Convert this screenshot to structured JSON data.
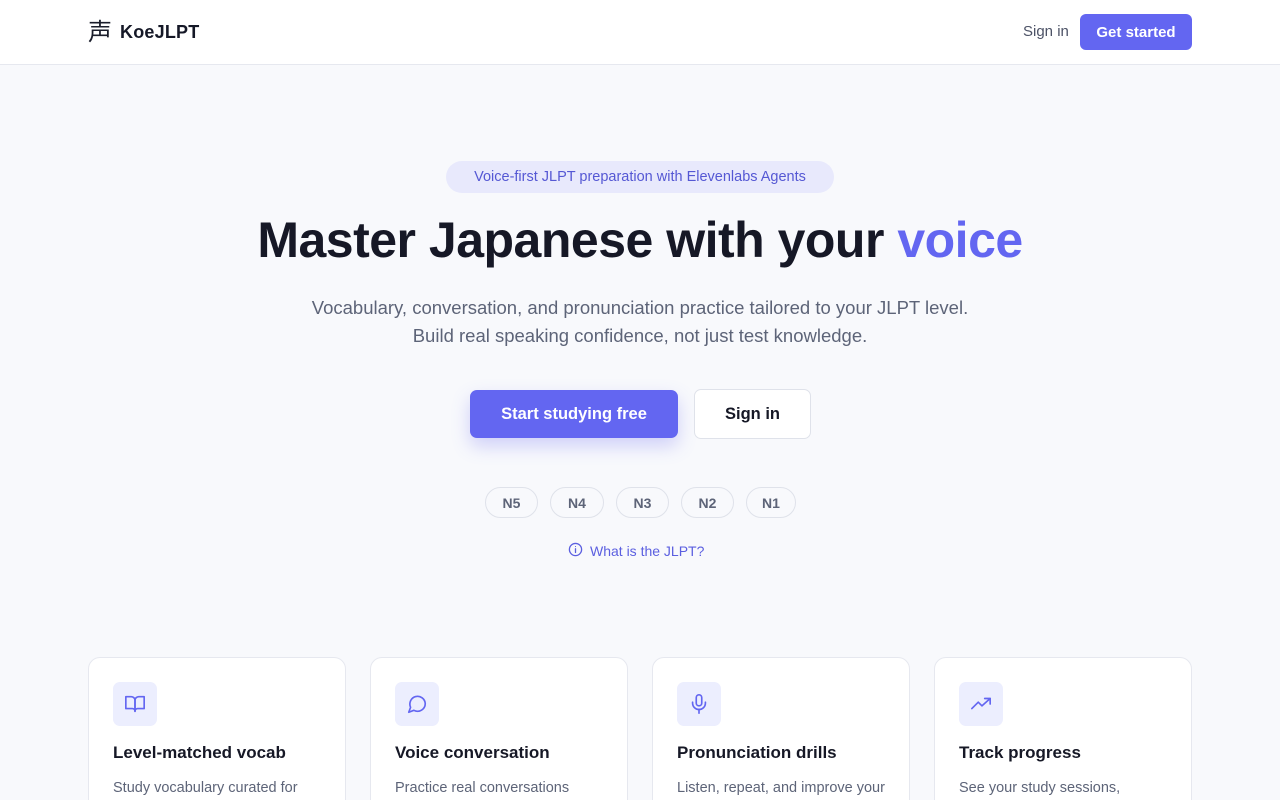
{
  "header": {
    "brand_mark": "声",
    "brand_name": "KoeJLPT",
    "sign_in_label": "Sign in",
    "get_started_label": "Get started"
  },
  "hero": {
    "pill_text": "Voice-first JLPT preparation with Elevenlabs Agents",
    "title_main": "Master Japanese with your ",
    "title_accent": "voice",
    "subtitle_line1": "Vocabulary, conversation, and pronunciation practice tailored to your JLPT level.",
    "subtitle_line2": "Build real speaking confidence, not just test knowledge.",
    "primary_cta": "Start studying free",
    "secondary_cta": "Sign in",
    "levels": [
      "N5",
      "N4",
      "N3",
      "N2",
      "N1"
    ],
    "jlpt_link": "What is the JLPT?"
  },
  "features": [
    {
      "icon": "book-open-icon",
      "title": "Level-matched vocab",
      "description": "Study vocabulary curated for"
    },
    {
      "icon": "message-circle-icon",
      "title": "Voice conversation",
      "description": "Practice real conversations"
    },
    {
      "icon": "microphone-icon",
      "title": "Pronunciation drills",
      "description": "Listen, repeat, and improve your"
    },
    {
      "icon": "trending-up-icon",
      "title": "Track progress",
      "description": "See your study sessions,"
    }
  ],
  "colors": {
    "accent": "#6366f1",
    "accent_soft": "#e8e9fc",
    "text_primary": "#161826",
    "text_muted": "#5d6478",
    "page_background": "#f8f9fc"
  }
}
